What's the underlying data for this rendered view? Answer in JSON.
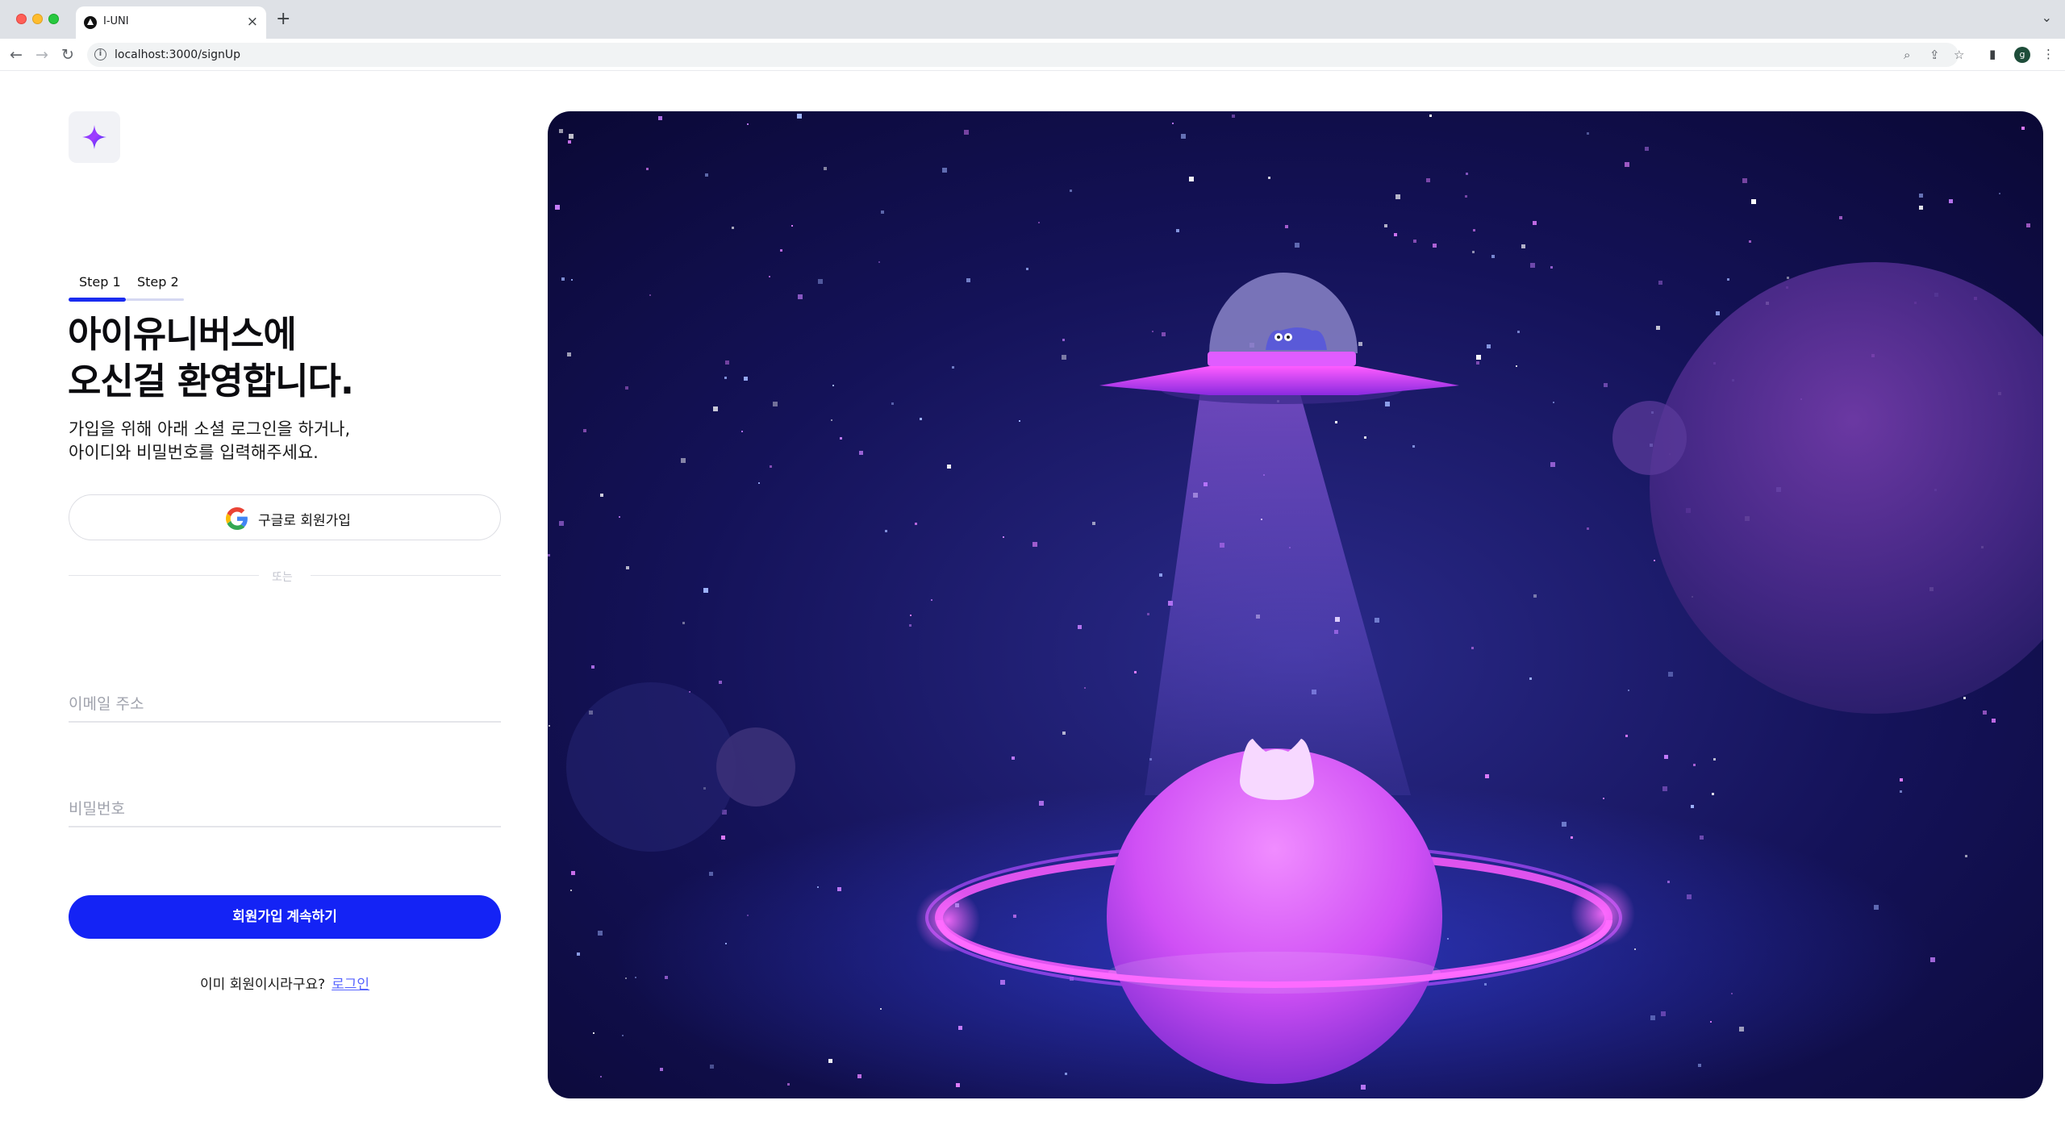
{
  "browser": {
    "tab_title": "I-UNI",
    "url": "localhost:3000/signUp",
    "profile_initial": "g"
  },
  "signup": {
    "steps": [
      "Step 1",
      "Step 2"
    ],
    "active_step": 1,
    "headline_line1": "아이유니버스에",
    "headline_line2": "오신걸 환영합니다.",
    "sub_line1": "가입을 위해 아래 소셜 로그인을 하거나,",
    "sub_line2": "아이디와 비밀번호를 입력해주세요.",
    "google_button": "구글로 회원가입",
    "divider": "또는",
    "email_placeholder": "이메일 주소",
    "password_placeholder": "비밀번호",
    "submit_button": "회원가입 계속하기",
    "already_member": "이미 회원이시라구요?",
    "login_link": "로그인"
  },
  "colors": {
    "primary": "#1423f5",
    "link": "#5764ff",
    "hero_bg_dark": "#0b0a3a",
    "planet_magenta": "#d64dff"
  }
}
